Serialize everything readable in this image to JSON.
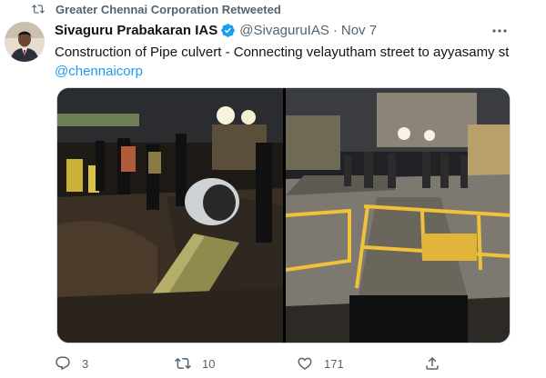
{
  "retweet_banner": {
    "text": "Greater Chennai Corporation Retweeted",
    "icon": "retweet-icon"
  },
  "tweet": {
    "author_name": "Sivaguru Prabakaran IAS",
    "verified": true,
    "handle": "@SivaguruIAS",
    "separator": "·",
    "date": "Nov 7",
    "text": "Construction of Pipe culvert - Connecting velayutham street to ayyasamy st",
    "mention": "@chennaicorp",
    "media_count": 2
  },
  "actions": {
    "replies": "3",
    "retweets": "10",
    "likes": "171",
    "share_icon": "share-icon"
  },
  "colors": {
    "accent": "#1d9bf0",
    "secondary_text": "#536471",
    "primary_text": "#0f1419"
  }
}
